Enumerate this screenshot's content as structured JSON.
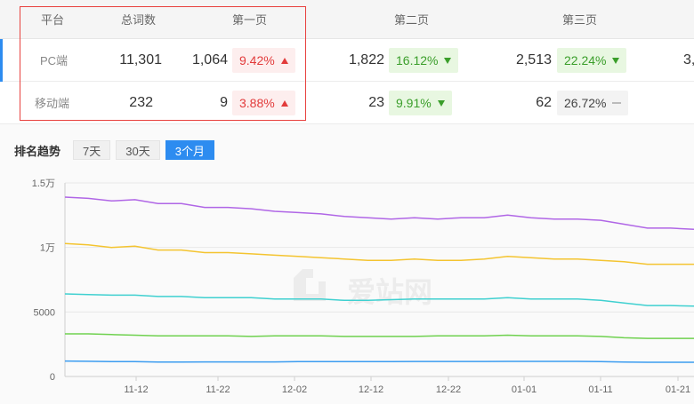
{
  "table": {
    "headers": {
      "platform": "平台",
      "total": "总词数",
      "page1": "第一页",
      "page2": "第二页",
      "page3": "第三页"
    },
    "rows": [
      {
        "platform": "PC端",
        "total": "11,301",
        "p1": {
          "count": "1,064",
          "pct": "9.42%",
          "trend": "up"
        },
        "p2": {
          "count": "1,822",
          "pct": "16.12%",
          "trend": "down"
        },
        "p3": {
          "count": "2,513",
          "pct": "22.24%",
          "trend": "down"
        },
        "p4_partial": "3,"
      },
      {
        "platform": "移动端",
        "total": "232",
        "p1": {
          "count": "9",
          "pct": "3.88%",
          "trend": "up"
        },
        "p2": {
          "count": "23",
          "pct": "9.91%",
          "trend": "down"
        },
        "p3": {
          "count": "62",
          "pct": "26.72%",
          "trend": "flat"
        }
      }
    ]
  },
  "trend": {
    "label": "排名趋势",
    "ranges": [
      "7天",
      "30天",
      "3个月"
    ],
    "active_range": "3个月"
  },
  "watermark": "爱站网",
  "colors": {
    "accent": "#2d8cf0",
    "up": "#e23b3b",
    "down": "#3a9e2a"
  },
  "chart_data": {
    "type": "line",
    "y_ticks": [
      "0",
      "5000",
      "1万",
      "1.5万"
    ],
    "ylim": [
      0,
      15000
    ],
    "x_ticks": [
      "11-12",
      "11-22",
      "12-02",
      "12-12",
      "12-22",
      "01-01",
      "01-11",
      "01-21"
    ],
    "series": [
      {
        "color": "#b066e6",
        "values": [
          13900,
          13800,
          13600,
          13700,
          13400,
          13400,
          13100,
          13100,
          13000,
          12800,
          12700,
          12600,
          12400,
          12300,
          12200,
          12300,
          12200,
          12300,
          12300,
          12500,
          12300,
          12200,
          12200,
          12100,
          11800,
          11500,
          11500,
          11400
        ]
      },
      {
        "color": "#f4c430",
        "values": [
          10300,
          10200,
          10000,
          10100,
          9800,
          9800,
          9600,
          9600,
          9500,
          9400,
          9300,
          9200,
          9100,
          9000,
          9000,
          9100,
          9000,
          9000,
          9100,
          9300,
          9200,
          9100,
          9100,
          9000,
          8900,
          8700,
          8700,
          8700
        ]
      },
      {
        "color": "#3fd0d0",
        "values": [
          6400,
          6350,
          6300,
          6300,
          6200,
          6200,
          6100,
          6100,
          6100,
          6000,
          6000,
          6000,
          5900,
          5900,
          5950,
          6000,
          6000,
          6000,
          6000,
          6100,
          6000,
          6000,
          6000,
          5900,
          5700,
          5500,
          5500,
          5450
        ]
      },
      {
        "color": "#6fd14f",
        "values": [
          3300,
          3300,
          3250,
          3200,
          3150,
          3150,
          3150,
          3150,
          3100,
          3150,
          3150,
          3150,
          3100,
          3100,
          3100,
          3100,
          3150,
          3150,
          3150,
          3200,
          3150,
          3150,
          3150,
          3100,
          3000,
          2950,
          2950,
          2950
        ]
      },
      {
        "color": "#3b9cf0",
        "values": [
          1200,
          1180,
          1150,
          1150,
          1120,
          1120,
          1130,
          1130,
          1130,
          1130,
          1150,
          1150,
          1150,
          1150,
          1150,
          1160,
          1160,
          1160,
          1160,
          1170,
          1170,
          1170,
          1170,
          1150,
          1120,
          1100,
          1100,
          1100
        ]
      }
    ]
  }
}
